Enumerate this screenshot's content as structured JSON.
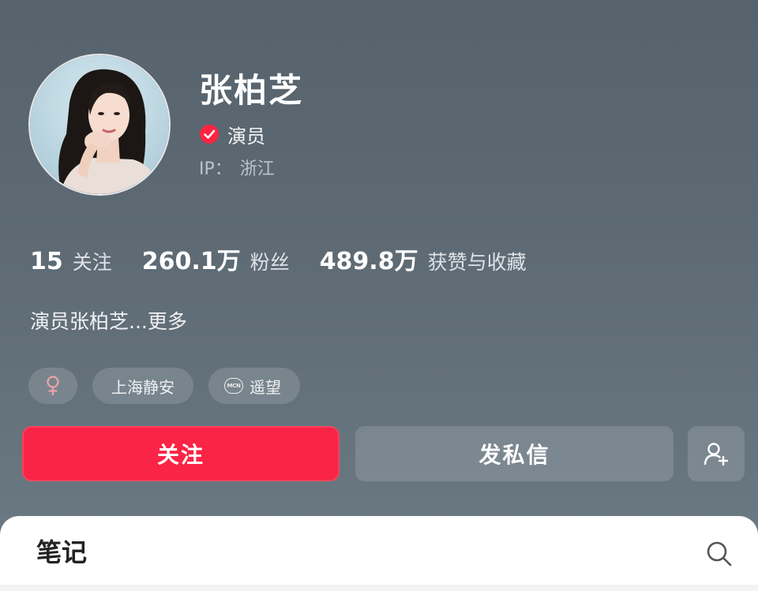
{
  "profile": {
    "name": "张柏芝",
    "verified_label": "演员",
    "ip_label": "IP：",
    "ip_value": "浙江",
    "bio": "演员张柏芝...更多"
  },
  "stats": [
    {
      "value": "15",
      "label": "关注"
    },
    {
      "value": "260.1万",
      "label": "粉丝"
    },
    {
      "value": "489.8万",
      "label": "获赞与收藏"
    }
  ],
  "tags": {
    "gender_icon": "female-icon",
    "location": "上海静安",
    "mcn_badge": "MCN",
    "mcn_name": "遥望"
  },
  "actions": {
    "follow_label": "关注",
    "message_label": "发私信",
    "add_friend_icon": "add-user-icon"
  },
  "bottom_panel": {
    "title": "笔记",
    "search_icon": "search-icon"
  },
  "colors": {
    "accent": "#fa2446",
    "verified": "#ff2442",
    "gender_icon": "#f0a3a8",
    "background": "#5d6a74"
  }
}
